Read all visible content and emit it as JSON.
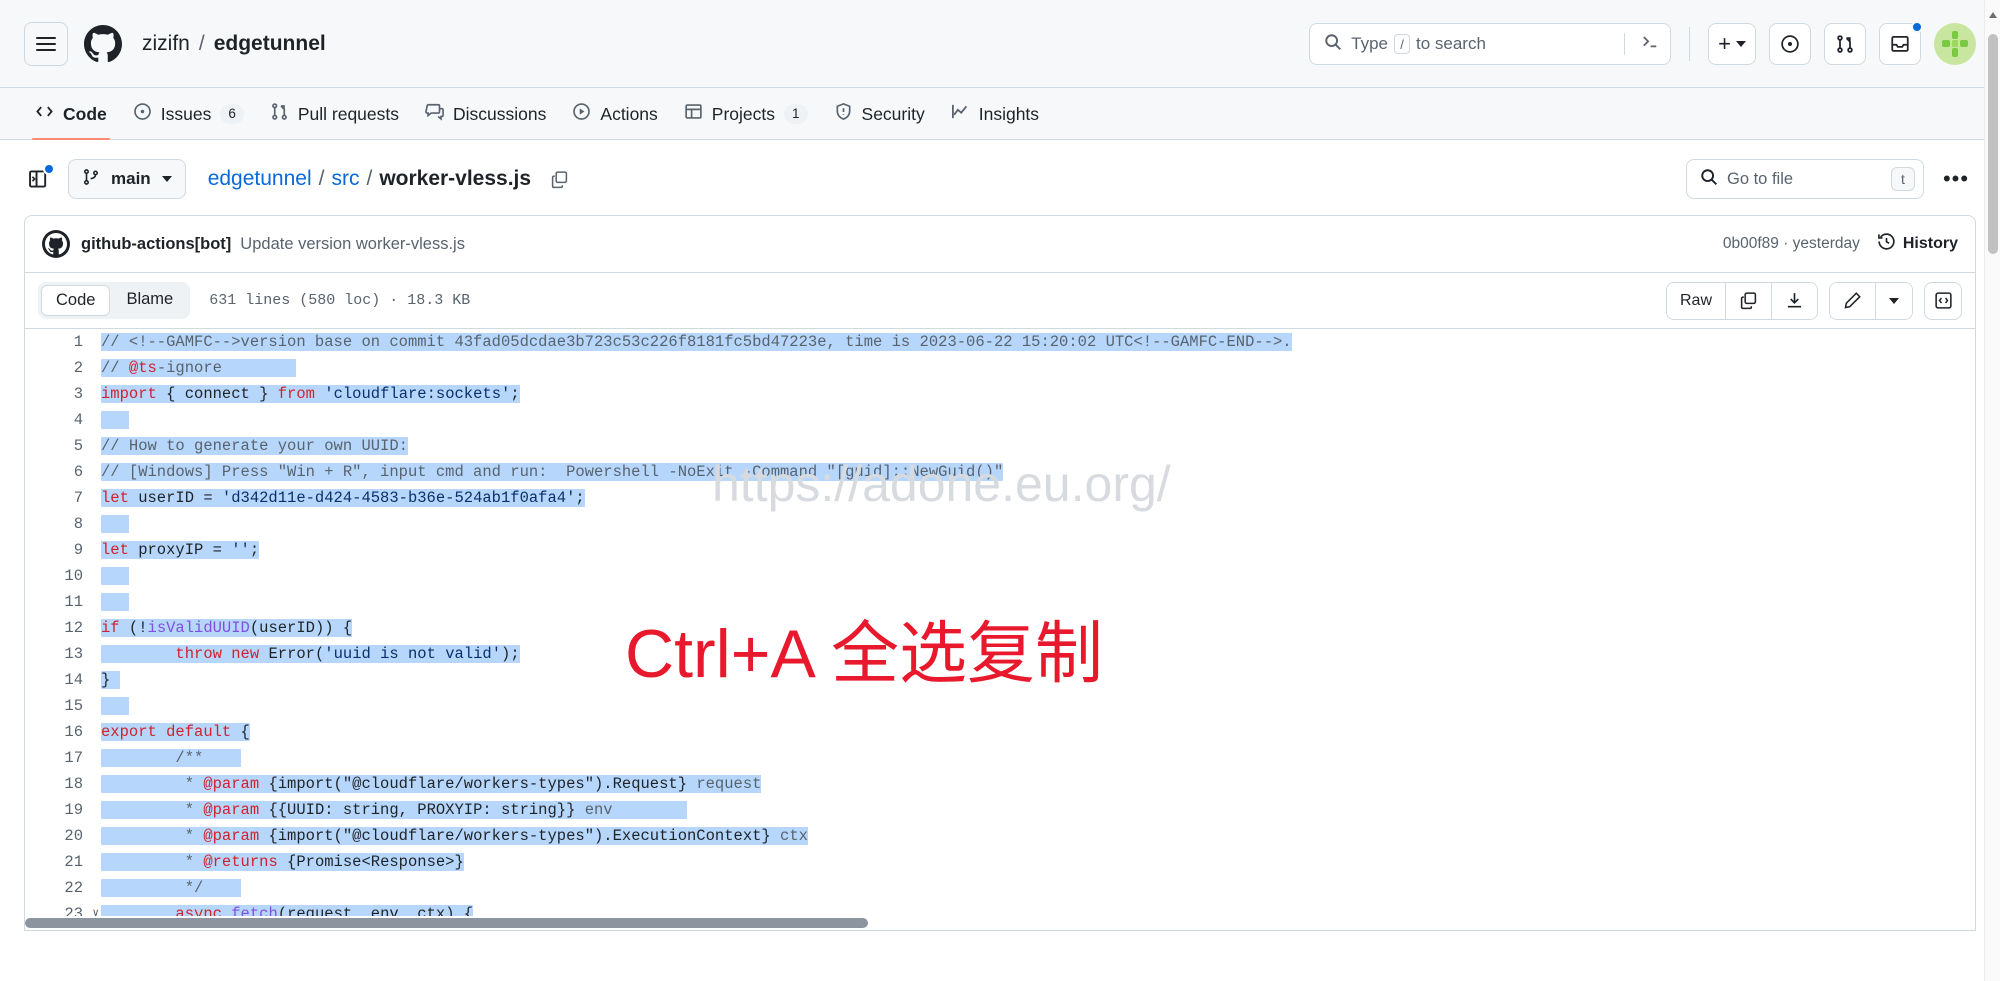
{
  "header": {
    "hamburger_icon": "hamburger-menu-icon",
    "logo_icon": "github-mark-icon",
    "owner": "zizifn",
    "separator": "/",
    "repo": "edgetunnel",
    "search_placeholder": "Type to search",
    "search_prefix": "Type",
    "search_key": "/",
    "search_suffix": "to search",
    "command_palette_icon": "terminal-prompt-icon",
    "create_new_label": "+",
    "issues_icon": "issue-opened-icon",
    "pullrequests_icon": "git-pull-request-icon",
    "inbox_icon": "inbox-icon",
    "avatar_icon": "user-avatar"
  },
  "repo_nav": [
    {
      "label": "Code",
      "icon": "code-icon",
      "count": null,
      "active": true
    },
    {
      "label": "Issues",
      "icon": "issue-opened-icon",
      "count": "6",
      "active": false
    },
    {
      "label": "Pull requests",
      "icon": "git-pull-request-icon",
      "count": null,
      "active": false
    },
    {
      "label": "Discussions",
      "icon": "comment-discussion-icon",
      "count": null,
      "active": false
    },
    {
      "label": "Actions",
      "icon": "play-icon",
      "count": null,
      "active": false
    },
    {
      "label": "Projects",
      "icon": "table-icon",
      "count": "1",
      "active": false
    },
    {
      "label": "Security",
      "icon": "shield-icon",
      "count": null,
      "active": false
    },
    {
      "label": "Insights",
      "icon": "graph-icon",
      "count": null,
      "active": false
    }
  ],
  "file_header": {
    "sidebar_toggle_icon": "sidebar-expand-icon",
    "branch_icon": "git-branch-icon",
    "branch_name": "main",
    "path": [
      {
        "label": "edgetunnel",
        "link": true
      },
      {
        "label": "src",
        "link": true
      },
      {
        "label": "worker-vless.js",
        "link": false
      }
    ],
    "path_separator": "/",
    "copy_path_icon": "copy-icon",
    "go_to_file_placeholder": "Go to file",
    "go_to_file_key": "t",
    "search_icon": "search-icon",
    "more_options_label": "•••"
  },
  "commit": {
    "avatar_icon": "github-actions-avatar",
    "author": "github-actions[bot]",
    "message": "Update version worker-vless.js",
    "sha": "0b00f89",
    "sha_time_separator": "·",
    "time": "yesterday",
    "history_icon": "history-icon",
    "history_label": "History"
  },
  "code_toolbar": {
    "tabs": [
      {
        "label": "Code",
        "active": true
      },
      {
        "label": "Blame",
        "active": false
      }
    ],
    "file_meta": "631 lines (580 loc) · 18.3 KB",
    "raw_label": "Raw",
    "copy_icon": "copy-raw-icon",
    "download_icon": "download-icon",
    "edit_icon": "pencil-edit-icon",
    "edit_dropdown_icon": "chevron-down-icon",
    "symbols_icon": "code-symbols-icon"
  },
  "overlays": {
    "watermark_url": "https://adone.eu.org/",
    "watermark_hint": "Ctrl+A 全选复制",
    "watermark_color": "#e8192c"
  },
  "code": {
    "lines": [
      {
        "n": "1",
        "fold": false,
        "tokens": [
          {
            "t": "// <!--GAMFC-->version base on commit 43fad05dcdae3b723c53c226f8181fc5bd47223e, time is 2023-06-22 15:20:02 UTC<!--GAMFC-END-->.",
            "c": "c-com",
            "s": true
          }
        ]
      },
      {
        "n": "2",
        "fold": false,
        "tokens": [
          {
            "t": "// ",
            "c": "c-com",
            "s": true
          },
          {
            "t": "@ts",
            "c": "c-kw",
            "s": true
          },
          {
            "t": "-ignore",
            "c": "c-com",
            "s": true
          },
          {
            "t": "        ",
            "c": "c-plain",
            "s": true
          }
        ]
      },
      {
        "n": "3",
        "fold": false,
        "tokens": [
          {
            "t": "import",
            "c": "c-kw",
            "s": true
          },
          {
            "t": " { ",
            "c": "c-plain",
            "s": true
          },
          {
            "t": "connect",
            "c": "c-plain",
            "s": true
          },
          {
            "t": " } ",
            "c": "c-plain",
            "s": true
          },
          {
            "t": "from",
            "c": "c-kw",
            "s": true
          },
          {
            "t": " ",
            "c": "c-plain",
            "s": true
          },
          {
            "t": "'cloudflare:sockets'",
            "c": "c-str",
            "s": true
          },
          {
            "t": ";",
            "c": "c-plain",
            "s": true
          }
        ]
      },
      {
        "n": "4",
        "fold": false,
        "tokens": [
          {
            "t": "   ",
            "c": "c-plain",
            "s": true
          }
        ]
      },
      {
        "n": "5",
        "fold": false,
        "tokens": [
          {
            "t": "// How to generate your own UUID:",
            "c": "c-com",
            "s": true
          }
        ]
      },
      {
        "n": "6",
        "fold": false,
        "tokens": [
          {
            "t": "// [Windows] Press \"Win + R\", input cmd and run:  Powershell -NoExit -Command \"[guid]::NewGuid()\"",
            "c": "c-com",
            "s": true
          }
        ]
      },
      {
        "n": "7",
        "fold": false,
        "tokens": [
          {
            "t": "let",
            "c": "c-kw",
            "s": true
          },
          {
            "t": " userID = ",
            "c": "c-plain",
            "s": true
          },
          {
            "t": "'d342d11e-d424-4583-b36e-524ab1f0afa4'",
            "c": "c-str",
            "s": true
          },
          {
            "t": ";",
            "c": "c-plain",
            "s": true
          }
        ]
      },
      {
        "n": "8",
        "fold": false,
        "tokens": [
          {
            "t": "   ",
            "c": "c-plain",
            "s": true
          }
        ]
      },
      {
        "n": "9",
        "fold": false,
        "tokens": [
          {
            "t": "let",
            "c": "c-kw",
            "s": true
          },
          {
            "t": " proxyIP = ",
            "c": "c-plain",
            "s": true
          },
          {
            "t": "''",
            "c": "c-str",
            "s": true
          },
          {
            "t": ";",
            "c": "c-plain",
            "s": true
          }
        ]
      },
      {
        "n": "10",
        "fold": false,
        "tokens": [
          {
            "t": "   ",
            "c": "c-plain",
            "s": true
          }
        ]
      },
      {
        "n": "11",
        "fold": false,
        "tokens": [
          {
            "t": "   ",
            "c": "c-plain",
            "s": true
          }
        ]
      },
      {
        "n": "12",
        "fold": false,
        "tokens": [
          {
            "t": "if",
            "c": "c-kw",
            "s": true
          },
          {
            "t": " (!",
            "c": "c-plain",
            "s": true
          },
          {
            "t": "isValidUUID",
            "c": "c-fn",
            "s": true
          },
          {
            "t": "(userID)) {",
            "c": "c-plain",
            "s": true
          }
        ]
      },
      {
        "n": "13",
        "fold": false,
        "tokens": [
          {
            "t": "        ",
            "c": "c-plain",
            "s": true
          },
          {
            "t": "throw",
            "c": "c-kw",
            "s": true
          },
          {
            "t": " ",
            "c": "c-plain",
            "s": true
          },
          {
            "t": "new",
            "c": "c-kw",
            "s": true
          },
          {
            "t": " ",
            "c": "c-plain",
            "s": true
          },
          {
            "t": "Error",
            "c": "c-plain",
            "s": true
          },
          {
            "t": "(",
            "c": "c-plain",
            "s": true
          },
          {
            "t": "'uuid is not valid'",
            "c": "c-str",
            "s": true
          },
          {
            "t": ");",
            "c": "c-plain",
            "s": true
          }
        ]
      },
      {
        "n": "14",
        "fold": false,
        "tokens": [
          {
            "t": "}",
            "c": "c-plain",
            "s": true
          },
          {
            "t": " ",
            "c": "c-plain",
            "s": true
          }
        ]
      },
      {
        "n": "15",
        "fold": false,
        "tokens": [
          {
            "t": "   ",
            "c": "c-plain",
            "s": true
          }
        ]
      },
      {
        "n": "16",
        "fold": false,
        "tokens": [
          {
            "t": "export",
            "c": "c-kw",
            "s": true
          },
          {
            "t": " ",
            "c": "c-plain",
            "s": true
          },
          {
            "t": "default",
            "c": "c-kw",
            "s": true
          },
          {
            "t": " {",
            "c": "c-plain",
            "s": true
          }
        ]
      },
      {
        "n": "17",
        "fold": false,
        "tokens": [
          {
            "t": "        ",
            "c": "c-plain",
            "s": true
          },
          {
            "t": "/**",
            "c": "c-com",
            "s": true
          },
          {
            "t": "    ",
            "c": "c-plain",
            "s": true
          }
        ]
      },
      {
        "n": "18",
        "fold": false,
        "tokens": [
          {
            "t": "         * ",
            "c": "c-com",
            "s": true
          },
          {
            "t": "@param",
            "c": "c-kw",
            "s": true
          },
          {
            "t": " {import(\"@cloudflare/workers-types\").Request}",
            "c": "c-plain",
            "s": true
          },
          {
            "t": " request",
            "c": "c-prm",
            "s": true
          }
        ]
      },
      {
        "n": "19",
        "fold": false,
        "tokens": [
          {
            "t": "         * ",
            "c": "c-com",
            "s": true
          },
          {
            "t": "@param",
            "c": "c-kw",
            "s": true
          },
          {
            "t": " {{UUID: string, PROXYIP: string}}",
            "c": "c-plain",
            "s": true
          },
          {
            "t": " env",
            "c": "c-prm",
            "s": true
          },
          {
            "t": "        ",
            "c": "c-plain",
            "s": true
          }
        ]
      },
      {
        "n": "20",
        "fold": false,
        "tokens": [
          {
            "t": "         * ",
            "c": "c-com",
            "s": true
          },
          {
            "t": "@param",
            "c": "c-kw",
            "s": true
          },
          {
            "t": " {import(\"@cloudflare/workers-types\").ExecutionContext}",
            "c": "c-plain",
            "s": true
          },
          {
            "t": " ctx",
            "c": "c-prm",
            "s": true
          }
        ]
      },
      {
        "n": "21",
        "fold": false,
        "tokens": [
          {
            "t": "         * ",
            "c": "c-com",
            "s": true
          },
          {
            "t": "@returns",
            "c": "c-kw",
            "s": true
          },
          {
            "t": " {Promise<Response>}",
            "c": "c-plain",
            "s": true
          }
        ]
      },
      {
        "n": "22",
        "fold": false,
        "tokens": [
          {
            "t": "         */",
            "c": "c-com",
            "s": true
          },
          {
            "t": "    ",
            "c": "c-plain",
            "s": true
          }
        ]
      },
      {
        "n": "23",
        "fold": true,
        "tokens": [
          {
            "t": "        ",
            "c": "c-plain",
            "s": true
          },
          {
            "t": "async",
            "c": "c-kw",
            "s": true
          },
          {
            "t": " ",
            "c": "c-plain",
            "s": true
          },
          {
            "t": "fetch",
            "c": "c-fn",
            "s": true
          },
          {
            "t": "(request, env, ctx) {",
            "c": "c-plain",
            "s": true
          }
        ]
      }
    ]
  }
}
